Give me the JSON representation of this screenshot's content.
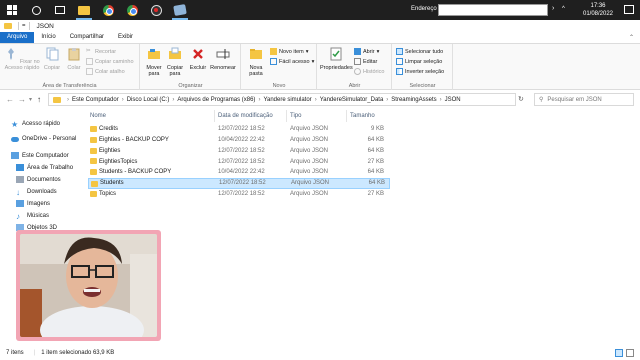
{
  "taskbar": {
    "address_label": "Endereço",
    "address_value": "",
    "tray_label": "^",
    "time": "17:36",
    "date": "01/08/2022"
  },
  "window": {
    "title": "JSON",
    "qa_dropdown": "="
  },
  "ribbon_tabs": [
    "Arquivo",
    "Início",
    "Compartilhar",
    "Exibir"
  ],
  "ribbon": {
    "clipboard": {
      "pin_label": "Fixar no Acesso rápido",
      "copy_label": "Copiar",
      "paste_label": "Colar",
      "cut_label": "Recortar",
      "copy_path_label": "Copiar caminho",
      "paste_shortcut_label": "Colar atalho",
      "group_label": "Área de Transferência"
    },
    "organize": {
      "move_label": "Mover para",
      "copy_to_label": "Copiar para",
      "delete_label": "Excluir",
      "rename_label": "Renomear",
      "group_label": "Organizar"
    },
    "new": {
      "new_folder_label": "Nova pasta",
      "new_item_label": "Novo item",
      "easy_access_label": "Fácil acesso",
      "group_label": "Novo"
    },
    "open": {
      "properties_label": "Propriedades",
      "open_label": "Abrir",
      "edit_label": "Editar",
      "history_label": "Histórico",
      "group_label": "Abrir"
    },
    "select": {
      "select_all_label": "Selecionar tudo",
      "select_none_label": "Limpar seleção",
      "invert_label": "Inverter seleção",
      "group_label": "Selecionar"
    }
  },
  "addressbar": {
    "breadcrumbs": [
      "Este Computador",
      "Disco Local (C:)",
      "Arquivos de Programas (x86)",
      "Yandere simulator",
      "YandereSimulator_Data",
      "StreamingAssets",
      "JSON"
    ],
    "search_placeholder": "Pesquisar em JSON"
  },
  "navpane": {
    "items": [
      {
        "label": "Acesso rápido",
        "icon": "star-icon"
      },
      {
        "label": "OneDrive - Personal",
        "icon": "cloud-icon"
      },
      {
        "label": "Este Computador",
        "icon": "computer-icon"
      },
      {
        "label": "Área de Trabalho",
        "icon": "desktop-icon"
      },
      {
        "label": "Documentos",
        "icon": "documents-icon"
      },
      {
        "label": "Downloads",
        "icon": "downloads-icon"
      },
      {
        "label": "Imagens",
        "icon": "pictures-icon"
      },
      {
        "label": "Músicas",
        "icon": "music-icon"
      },
      {
        "label": "Objetos 3D",
        "icon": "3d-objects-icon"
      }
    ]
  },
  "filelist": {
    "columns": [
      "Nome",
      "Data de modificação",
      "Tipo",
      "Tamanho"
    ],
    "rows": [
      {
        "name": "Credits",
        "date": "12/07/2022 18:52",
        "type": "Arquivo JSON",
        "size": "9 KB",
        "selected": false
      },
      {
        "name": "Eighties - BACKUP COPY",
        "date": "10/04/2022 22:42",
        "type": "Arquivo JSON",
        "size": "64 KB",
        "selected": false
      },
      {
        "name": "Eighties",
        "date": "12/07/2022 18:52",
        "type": "Arquivo JSON",
        "size": "64 KB",
        "selected": false
      },
      {
        "name": "EightiesTopics",
        "date": "12/07/2022 18:52",
        "type": "Arquivo JSON",
        "size": "27 KB",
        "selected": false
      },
      {
        "name": "Students - BACKUP COPY",
        "date": "10/04/2022 22:42",
        "type": "Arquivo JSON",
        "size": "64 KB",
        "selected": false
      },
      {
        "name": "Students",
        "date": "12/07/2022 18:52",
        "type": "Arquivo JSON",
        "size": "64 KB",
        "selected": true
      },
      {
        "name": "Topics",
        "date": "12/07/2022 18:52",
        "type": "Arquivo JSON",
        "size": "27 KB",
        "selected": false
      }
    ]
  },
  "statusbar": {
    "item_count": "7 itens",
    "selection": "1 item selecionado  63,9 KB"
  },
  "colors": {
    "accent": "#1a6fc9",
    "selection": "#cce8ff",
    "webcam_border": "#f2a5b4"
  }
}
